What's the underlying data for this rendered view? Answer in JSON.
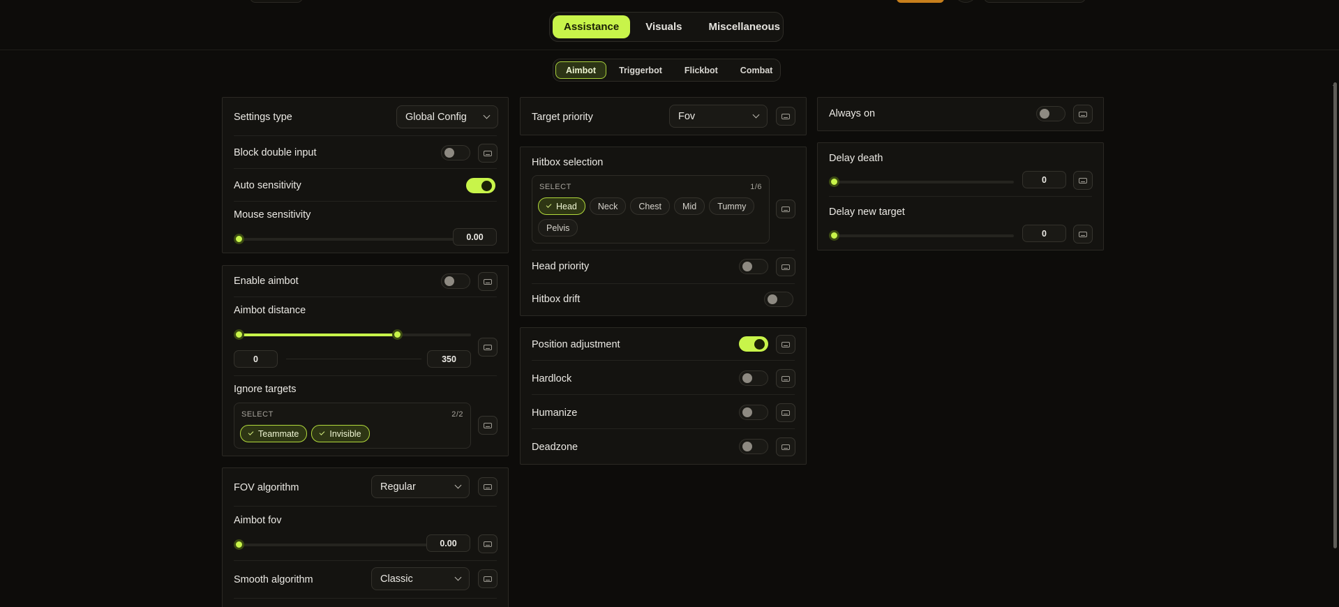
{
  "main_tabs": [
    {
      "label": "Assistance",
      "active": true
    },
    {
      "label": "Visuals",
      "active": false
    },
    {
      "label": "Miscellaneous",
      "active": false
    }
  ],
  "sub_tabs": [
    {
      "label": "Aimbot",
      "active": true
    },
    {
      "label": "Triggerbot",
      "active": false
    },
    {
      "label": "Flickbot",
      "active": false
    },
    {
      "label": "Combat",
      "active": false
    }
  ],
  "col1": {
    "panel1": {
      "settings_type_label": "Settings type",
      "settings_type_value": "Global Config",
      "block_double_input_label": "Block double input",
      "block_double_input_on": false,
      "auto_sensitivity_label": "Auto sensitivity",
      "auto_sensitivity_on": true,
      "mouse_sensitivity_label": "Mouse sensitivity",
      "mouse_sensitivity_value": "0.00",
      "mouse_sensitivity_fraction": 0
    },
    "panel2": {
      "enable_aimbot_label": "Enable aimbot",
      "enable_aimbot_on": false,
      "aimbot_distance_label": "Aimbot distance",
      "aimbot_distance_min": "0",
      "aimbot_distance_max": "350",
      "aimbot_distance_range_fraction": [
        0,
        0.68
      ],
      "ignore_targets_label": "Ignore targets",
      "ignore_targets_select": "SELECT",
      "ignore_targets_count": "2/2",
      "ignore_targets_chips": [
        {
          "label": "Teammate",
          "selected": true
        },
        {
          "label": "Invisible",
          "selected": true
        }
      ]
    },
    "panel3": {
      "fov_algorithm_label": "FOV algorithm",
      "fov_algorithm_value": "Regular",
      "aimbot_fov_label": "Aimbot fov",
      "aimbot_fov_value": "0.00",
      "aimbot_fov_fraction": 0,
      "smooth_algorithm_label": "Smooth algorithm",
      "smooth_algorithm_value": "Classic"
    }
  },
  "col2": {
    "panel1": {
      "target_priority_label": "Target priority",
      "target_priority_value": "Fov"
    },
    "panel2": {
      "hitbox_selection_label": "Hitbox selection",
      "hitbox_select": "SELECT",
      "hitbox_count": "1/6",
      "hitbox_chips": [
        {
          "label": "Head",
          "selected": true
        },
        {
          "label": "Neck",
          "selected": false
        },
        {
          "label": "Chest",
          "selected": false
        },
        {
          "label": "Mid",
          "selected": false
        },
        {
          "label": "Tummy",
          "selected": false
        },
        {
          "label": "Pelvis",
          "selected": false
        }
      ],
      "head_priority_label": "Head priority",
      "head_priority_on": false,
      "hitbox_drift_label": "Hitbox drift",
      "hitbox_drift_on": false
    },
    "panel3": {
      "position_adjustment_label": "Position adjustment",
      "position_adjustment_on": true,
      "hardlock_label": "Hardlock",
      "hardlock_on": false,
      "humanize_label": "Humanize",
      "humanize_on": false,
      "deadzone_label": "Deadzone",
      "deadzone_on": false
    }
  },
  "col3": {
    "panel1": {
      "always_on_label": "Always on",
      "always_on_on": false
    },
    "panel2": {
      "delay_death_label": "Delay death",
      "delay_death_value": "0",
      "delay_death_fraction": 0,
      "delay_new_target_label": "Delay new target",
      "delay_new_target_value": "0",
      "delay_new_target_fraction": 0
    }
  },
  "icons": {
    "keybind": "keyboard-icon",
    "dropdown": "chevron-down-icon",
    "check": "check-icon"
  },
  "colors": {
    "accent": "#c8f44a",
    "background": "#0d0c0a",
    "panel": "#141310"
  }
}
